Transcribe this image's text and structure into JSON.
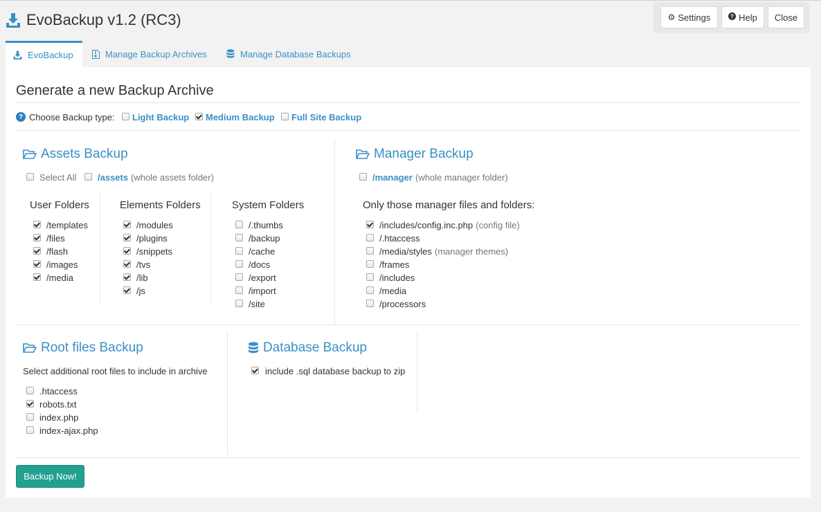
{
  "app": {
    "title": "EvoBackup v1.2 (RC3)"
  },
  "toolbar": {
    "settings": "Settings",
    "help": "Help",
    "close": "Close"
  },
  "tabs": [
    "EvoBackup",
    "Manage Backup Archives",
    "Manage Database Backups"
  ],
  "main": {
    "heading": "Generate a new Backup Archive",
    "type_label": "Choose Backup type:",
    "types": [
      {
        "label": "Light Backup",
        "checked": false
      },
      {
        "label": "Medium Backup",
        "checked": true
      },
      {
        "label": "Full Site Backup",
        "checked": false
      }
    ]
  },
  "assets": {
    "title": "Assets Backup",
    "select_all": "Select All",
    "assets_link": "/assets",
    "assets_note": "(whole assets folder)",
    "user_title": "User Folders",
    "user": [
      {
        "label": "/templates",
        "checked": true
      },
      {
        "label": "/files",
        "checked": true
      },
      {
        "label": "/flash",
        "checked": true
      },
      {
        "label": "/images",
        "checked": true
      },
      {
        "label": "/media",
        "checked": true
      }
    ],
    "elements_title": "Elements Folders",
    "elements": [
      {
        "label": "/modules",
        "checked": true
      },
      {
        "label": "/plugins",
        "checked": true
      },
      {
        "label": "/snippets",
        "checked": true
      },
      {
        "label": "/tvs",
        "checked": true
      },
      {
        "label": "/lib",
        "checked": true
      },
      {
        "label": "/js",
        "checked": true
      }
    ],
    "system_title": "System Folders",
    "system": [
      {
        "label": "/.thumbs",
        "checked": false
      },
      {
        "label": "/backup",
        "checked": false
      },
      {
        "label": "/cache",
        "checked": false
      },
      {
        "label": "/docs",
        "checked": false
      },
      {
        "label": "/export",
        "checked": false
      },
      {
        "label": "/import",
        "checked": false
      },
      {
        "label": "/site",
        "checked": false
      }
    ]
  },
  "manager": {
    "title": "Manager Backup",
    "manager_link": "/manager",
    "manager_note": "(whole manager folder)",
    "only_title": "Only those manager files and folders:",
    "items": [
      {
        "label": "/includes/config.inc.php",
        "note": "(config file)",
        "checked": true
      },
      {
        "label": "/.htaccess",
        "note": "",
        "checked": false
      },
      {
        "label": "/media/styles",
        "note": "(manager themes)",
        "checked": false
      },
      {
        "label": "/frames",
        "note": "",
        "checked": false
      },
      {
        "label": "/includes",
        "note": "",
        "checked": false
      },
      {
        "label": "/media",
        "note": "",
        "checked": false
      },
      {
        "label": "/processors",
        "note": "",
        "checked": false
      }
    ]
  },
  "root": {
    "title": "Root files Backup",
    "desc": "Select additional root files to include in archive",
    "items": [
      {
        "label": ".htaccess",
        "checked": false
      },
      {
        "label": "robots.txt",
        "checked": true
      },
      {
        "label": "index.php",
        "checked": false
      },
      {
        "label": "index-ajax.php",
        "checked": false
      }
    ]
  },
  "database": {
    "title": "Database Backup",
    "option": {
      "label": "include .sql database backup to zip",
      "checked": true
    }
  },
  "actions": {
    "backup_now": "Backup Now!"
  },
  "colors": {
    "accent": "#3a8fc6",
    "button": "#22a190"
  }
}
